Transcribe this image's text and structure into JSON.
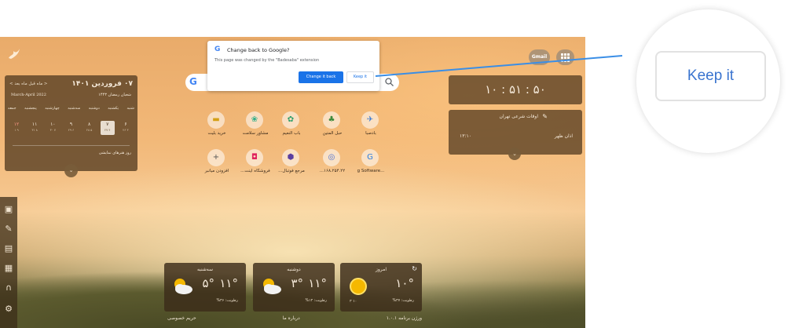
{
  "extension_popup": {
    "title": "Change back to Google?",
    "body": "This page was changed by the \"Badesaba\" extension",
    "change_button": "Change it back",
    "keep_button": "Keep it"
  },
  "zoom_callout": {
    "label": "Keep it"
  },
  "header": {
    "gmail": "Gmail"
  },
  "calendar": {
    "title": "۰۷ فروردین ۱۴۰۱",
    "nav": "< ماه قبل  ماه بعد >",
    "gregorian": "March-April 2022",
    "hijri": "شعبان رمضان ۱۴۴۳",
    "weekdays": [
      "شنبه",
      "یکشنبه",
      "دوشنبه",
      "سه‌شنبه",
      "چهارشنبه",
      "پنجشنبه",
      "جمعه"
    ],
    "days": [
      {
        "d": "۶",
        "sub": "۲۶ ۳"
      },
      {
        "d": "۷",
        "sub": "۲۷ ۴"
      },
      {
        "d": "۸",
        "sub": "۲۸ ۵"
      },
      {
        "d": "۹",
        "sub": "۲۹ ۶"
      },
      {
        "d": "۱۰",
        "sub": "۳۰ ۷"
      },
      {
        "d": "۱۱",
        "sub": "۳۱ ۸"
      },
      {
        "d": "۱۲",
        "sub": "۱ ۹"
      }
    ],
    "event": "روز هنرهای نمایشی"
  },
  "clock": {
    "time": "۱۰ : ۵۱ : ۵۰"
  },
  "prayer": {
    "title": "اوقات شرعی تهران",
    "name": "اذان ظهر",
    "time": "۱۳:۱۰"
  },
  "shortcuts": [
    {
      "label": "بادصبا",
      "icon": "✈",
      "color": "#3a7bd5"
    },
    {
      "label": "حبل المتین",
      "icon": "♣",
      "color": "#3d8b3d"
    },
    {
      "label": "باب النعیم",
      "icon": "✿",
      "color": "#2e9e6a"
    },
    {
      "label": "مشاور سلامت",
      "icon": "❀",
      "color": "#2fae8a"
    },
    {
      "label": "خرید بلیت",
      "icon": "▬",
      "color": "#d4a017"
    },
    {
      "label": "g Software...",
      "icon": "G",
      "color": "#2a7de1"
    },
    {
      "label": "۱۶۸.۲۵۴.۲۲...",
      "icon": "◎",
      "color": "#4a6fd1"
    },
    {
      "label": "مرجع فوتبال...",
      "icon": "⬢",
      "color": "#5a3fa0"
    },
    {
      "label": "فروشگاه اینت...",
      "icon": "◘",
      "color": "#e0245e"
    },
    {
      "label": "افزودن میانبر",
      "icon": "+",
      "color": "#555555"
    }
  ],
  "weather": [
    {
      "day": "امروز",
      "temp": "۱۰°",
      "humidity": "رطوبت: ۳۷%",
      "lohi": "۳   ۱۰",
      "icon": "sun"
    },
    {
      "day": "دوشنبه",
      "temp": "۱۱°",
      "temp_lo": "۳°",
      "humidity": "رطوبت: ۱۴%",
      "icon": "partly-cloudy"
    },
    {
      "day": "سه‌شنبه",
      "temp": "۱۱°",
      "temp_lo": "۵°",
      "humidity": "رطوبت: ۳۶%",
      "icon": "partly-cloudy"
    }
  ],
  "footer": {
    "version": "ورژن برنامه ۱.۰.۱",
    "about": "درباره ما",
    "privacy": "حریم خصوصی"
  },
  "colors": {
    "accent": "#1a73e8",
    "card": "#5c4226"
  }
}
